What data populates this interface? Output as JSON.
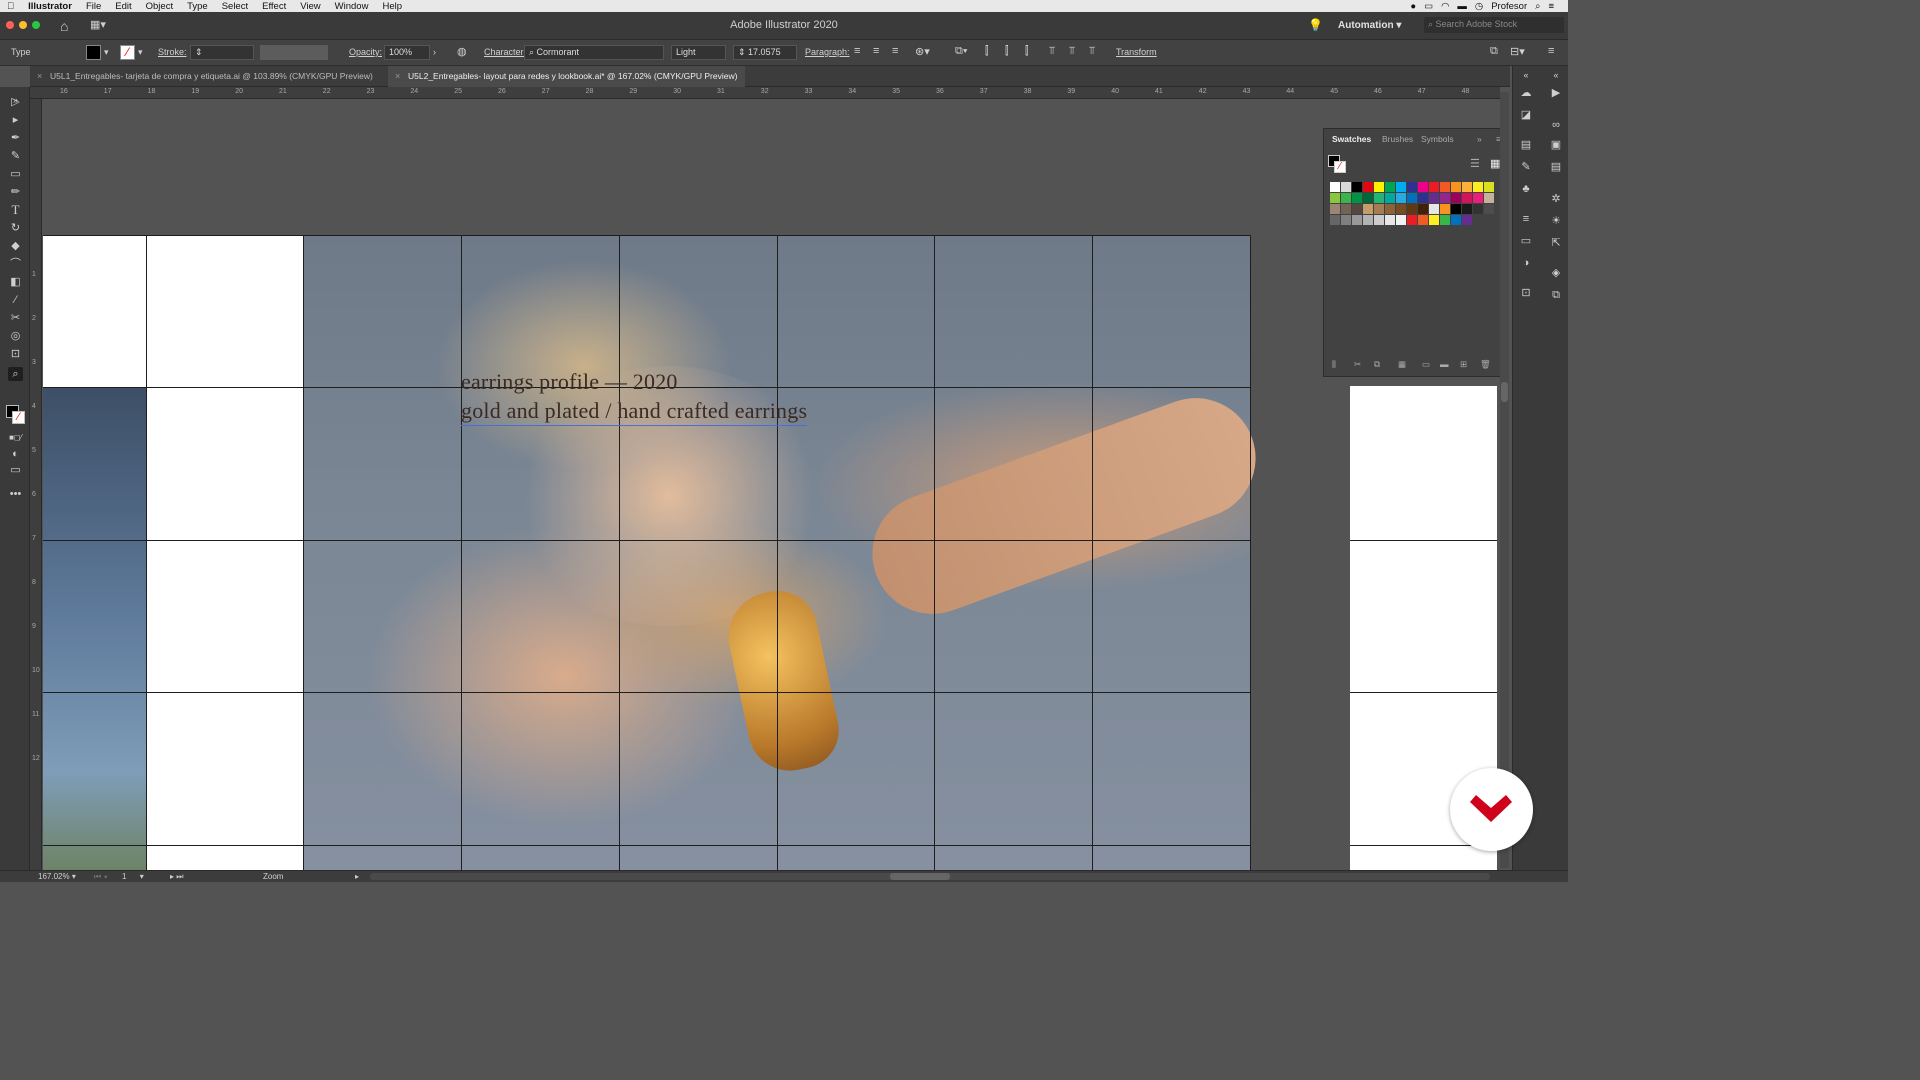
{
  "menubar": {
    "apple_icon": "apple-icon",
    "app_name": "Illustrator",
    "items": [
      "File",
      "Edit",
      "Object",
      "Type",
      "Select",
      "Effect",
      "View",
      "Window",
      "Help"
    ],
    "user": "Profesor"
  },
  "window": {
    "title": "Adobe Illustrator 2020",
    "workspace": "Automation",
    "search_placeholder": "Search Adobe Stock"
  },
  "control_bar": {
    "tool_label": "Type",
    "stroke_label": "Stroke:",
    "opacity_label": "Opacity:",
    "opacity_value": "100%",
    "character_label": "Character:",
    "font_family": "Cormorant",
    "font_style": "Light",
    "font_size": "17.0575",
    "paragraph_label": "Paragraph:",
    "transform_label": "Transform"
  },
  "tabs": [
    {
      "label": "U5L1_Entregables- tarjeta de compra y etiqueta.ai @ 103.89% (CMYK/GPU Preview)",
      "active": false
    },
    {
      "label": "U5L2_Entregables- layout para redes y lookbook.ai* @ 167.02% (CMYK/GPU Preview)",
      "active": true
    }
  ],
  "ruler_h": [
    "16",
    "17",
    "18",
    "19",
    "20",
    "21",
    "22",
    "23",
    "24",
    "25",
    "26",
    "27",
    "28",
    "29",
    "30",
    "31",
    "32",
    "33",
    "34",
    "35",
    "36",
    "37",
    "38",
    "39",
    "40",
    "41",
    "42",
    "43",
    "44",
    "45",
    "46",
    "47",
    "48"
  ],
  "ruler_v": [
    "1",
    "2",
    "3",
    "4",
    "5",
    "6",
    "7",
    "8",
    "9",
    "10",
    "11",
    "12"
  ],
  "canvas": {
    "headline_line1": "earrings profile — 2020",
    "headline_line2": "gold and plated / hand crafted earrings"
  },
  "swatches_panel": {
    "tabs": [
      "Swatches",
      "Brushes",
      "Symbols"
    ],
    "colors": [
      "#ffffff",
      "#d9d9d9",
      "#000000",
      "#e30613",
      "#fff200",
      "#00a651",
      "#00aeef",
      "#2e3192",
      "#ec008c",
      "#ed1c24",
      "#f15a24",
      "#f7941d",
      "#fbb03b",
      "#fcee21",
      "#d9e021",
      "#8cc63f",
      "#39b54a",
      "#009245",
      "#006837",
      "#22b573",
      "#00a99d",
      "#29abe2",
      "#0071bc",
      "#2e3192",
      "#662d91",
      "#93278f",
      "#9e005d",
      "#d4145a",
      "#ed1e79",
      "#c7b299",
      "#998675",
      "#736357",
      "#534741",
      "#c69c6d",
      "#a67c52",
      "#8c6239",
      "#754c24",
      "#603813",
      "#42210b",
      "#e6e6e6",
      "#f7931e",
      "#000000",
      "#1a1a1a",
      "#333333",
      "#4d4d4d",
      "#666666",
      "#808080",
      "#999999",
      "#b3b3b3",
      "#cccccc",
      "#e6e6e6",
      "#f2f2f2",
      "#ed1c24",
      "#f15a24",
      "#fcee21",
      "#39b54a",
      "#0071bc",
      "#662d91"
    ]
  },
  "status_bar": {
    "zoom": "167.02%",
    "artboard": "1",
    "tool": "Zoom"
  },
  "colors": {
    "ui_dark": "#3a3a3a",
    "canvas_bg": "#535353",
    "grid_line": "#1e1e1e",
    "badge_red": "#d0021b"
  }
}
